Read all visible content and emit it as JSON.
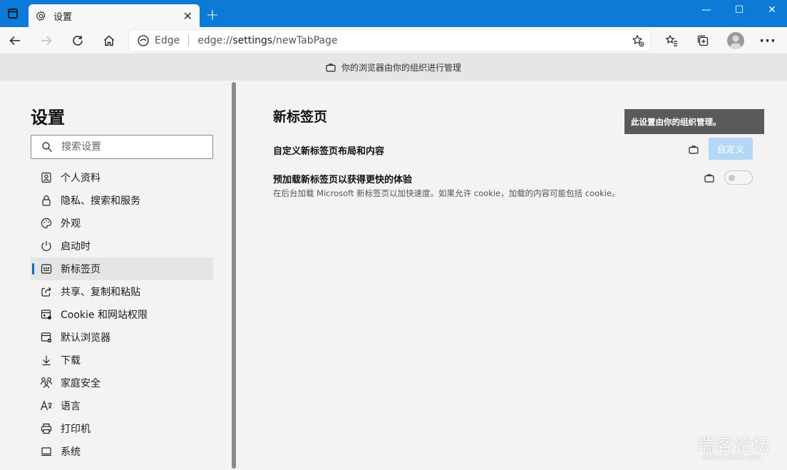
{
  "tab": {
    "title": "设置"
  },
  "window_controls": {
    "minimize": "—",
    "maximize": "☐",
    "close": "✕"
  },
  "address": {
    "site_label": "Edge",
    "url_prefix": "edge://",
    "url_host": "settings",
    "url_path": "/newTabPage"
  },
  "banner": {
    "text": "你的浏览器由你的组织进行管理"
  },
  "sidebar": {
    "title": "设置",
    "search_placeholder": "搜索设置",
    "items": [
      {
        "label": "个人资料",
        "icon": "profile-icon"
      },
      {
        "label": "隐私、搜索和服务",
        "icon": "lock-icon"
      },
      {
        "label": "外观",
        "icon": "palette-icon"
      },
      {
        "label": "启动时",
        "icon": "power-icon"
      },
      {
        "label": "新标签页",
        "icon": "new-tab-icon"
      },
      {
        "label": "共享、复制和粘贴",
        "icon": "share-icon"
      },
      {
        "label": "Cookie 和网站权限",
        "icon": "site-permissions-icon"
      },
      {
        "label": "默认浏览器",
        "icon": "browser-icon"
      },
      {
        "label": "下载",
        "icon": "download-icon"
      },
      {
        "label": "家庭安全",
        "icon": "family-icon"
      },
      {
        "label": "语言",
        "icon": "language-icon"
      },
      {
        "label": "打印机",
        "icon": "printer-icon"
      },
      {
        "label": "系统",
        "icon": "system-icon"
      }
    ]
  },
  "main": {
    "title": "新标签页",
    "tooltip": "此设置由你的组织管理。",
    "customize": {
      "label": "自定义新标签页布局和内容",
      "button": "自定义"
    },
    "preload": {
      "label": "预加载新标签页以获得更快的体验",
      "description": "在后台加载 Microsoft 新标签页以加快速度。如果允许 cookie，加载的内容可能包括 cookie。",
      "enabled": false
    }
  },
  "watermark": {
    "text": "瑞客论坛",
    "sub": "www.ruike1.com"
  }
}
